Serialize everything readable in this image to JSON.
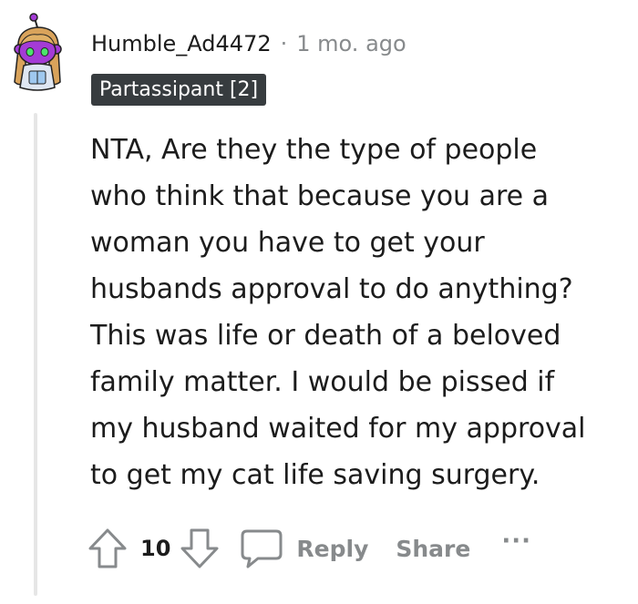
{
  "comment": {
    "author": "Humble_Ad4472",
    "separator": "·",
    "timestamp": "1 mo. ago",
    "flair": "Partassipant [2]",
    "body": "NTA, Are they the type of people\nwho think that because you are a\nwoman you have to get your\nhusbands approval to do anything?\nThis was life or death of a beloved\nfamily matter. I would be pissed if\nmy husband waited for my approval\nto get my cat life saving surgery."
  },
  "actions": {
    "upvote_icon": "arrow-up-icon",
    "vote_count": "10",
    "downvote_icon": "arrow-down-icon",
    "reply_icon": "speech-bubble-icon",
    "reply_label": "Reply",
    "share_label": "Share",
    "more_label": "···"
  },
  "colors": {
    "text": "#1c1c1c",
    "muted": "#878a8c",
    "flair_bg": "#373c3f",
    "avatar_purple": "#a43bd6"
  }
}
